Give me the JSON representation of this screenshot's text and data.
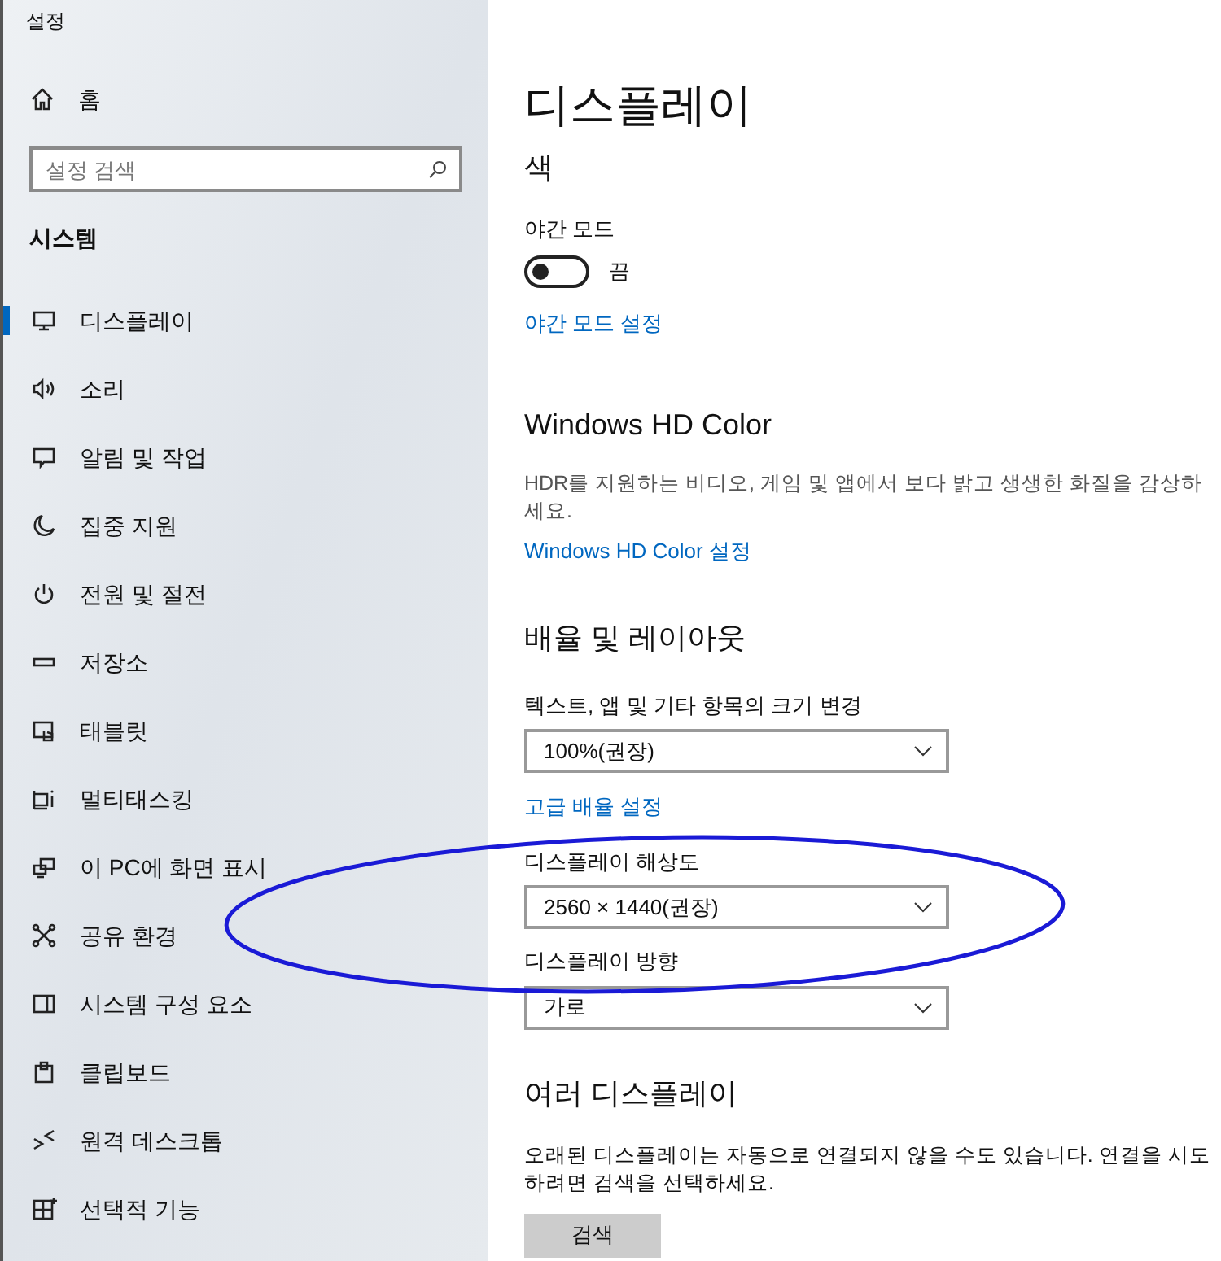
{
  "window": {
    "title": "설정"
  },
  "sidebar": {
    "home": "홈",
    "search": {
      "placeholder": "설정 검색"
    },
    "section": "시스템",
    "items": [
      {
        "label": "디스플레이",
        "selected": true
      },
      {
        "label": "소리",
        "selected": false
      },
      {
        "label": "알림 및 작업",
        "selected": false
      },
      {
        "label": "집중 지원",
        "selected": false
      },
      {
        "label": "전원 및 절전",
        "selected": false
      },
      {
        "label": "저장소",
        "selected": false
      },
      {
        "label": "태블릿",
        "selected": false
      },
      {
        "label": "멀티태스킹",
        "selected": false
      },
      {
        "label": "이 PC에 화면 표시",
        "selected": false
      },
      {
        "label": "공유 환경",
        "selected": false
      },
      {
        "label": "시스템 구성 요소",
        "selected": false
      },
      {
        "label": "클립보드",
        "selected": false
      },
      {
        "label": "원격 데스크톱",
        "selected": false
      },
      {
        "label": "선택적 기능",
        "selected": false
      }
    ]
  },
  "page": {
    "title": "디스플레이",
    "color": {
      "heading": "색",
      "night_mode": {
        "label": "야간 모드",
        "on": false,
        "status": "끔"
      },
      "link": "야간 모드 설정"
    },
    "hd_color": {
      "heading": "Windows HD Color",
      "description": "HDR를 지원하는 비디오, 게임 및 앱에서 보다 밝고 생생한 화질을 감상하세요.",
      "link": "Windows HD Color 설정"
    },
    "scale_layout": {
      "heading": "배율 및 레이아웃",
      "scale": {
        "label": "텍스트, 앱 및 기타 항목의 크기 변경",
        "value": "100%(권장)"
      },
      "link": "고급 배율 설정",
      "resolution": {
        "label": "디스플레이 해상도",
        "value": "2560 × 1440(권장)"
      },
      "orientation": {
        "label": "디스플레이 방향",
        "value": "가로"
      }
    },
    "multiple_displays": {
      "heading": "여러 디스플레이",
      "description": "오래된 디스플레이는 자동으로 연결되지 않을 수도 있습니다. 연결을 시도하려면 검색을 선택하세요.",
      "button": "검색"
    }
  }
}
